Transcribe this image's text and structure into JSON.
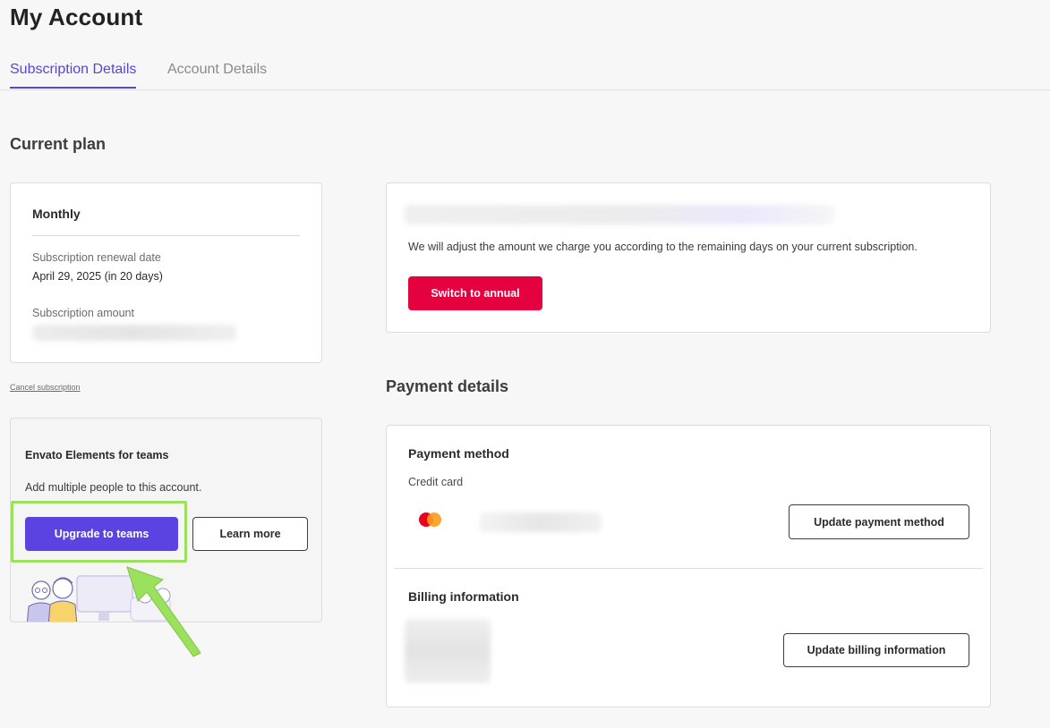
{
  "page": {
    "title": "My Account",
    "tabs": [
      {
        "label": "Subscription Details",
        "active": true
      },
      {
        "label": "Account Details",
        "active": false
      }
    ]
  },
  "current_plan": {
    "section_title": "Current plan",
    "plan_name": "Monthly",
    "renewal_label": "Subscription renewal date",
    "renewal_value": "April 29, 2025 (in 20 days)",
    "amount_label": "Subscription amount",
    "cancel_link": "Cancel subscription"
  },
  "teams": {
    "title": "Envato Elements for teams",
    "description": "Add multiple people to this account.",
    "upgrade_button": "Upgrade to teams",
    "learn_more_button": "Learn more"
  },
  "annual": {
    "description": "We will adjust the amount we charge you according to the remaining days on your current subscription.",
    "switch_button": "Switch to annual"
  },
  "payment": {
    "section_title": "Payment details",
    "method_title": "Payment method",
    "method_type": "Credit card",
    "update_method_button": "Update payment method",
    "billing_title": "Billing information",
    "update_billing_button": "Update billing information"
  },
  "colors": {
    "accent": "#5a43e0",
    "danger": "#e5003e",
    "highlight": "#9be15d",
    "background": "#f7f7f7"
  },
  "icons": [
    "mastercard-icon",
    "arrow-annotation-icon",
    "team-illustration"
  ]
}
